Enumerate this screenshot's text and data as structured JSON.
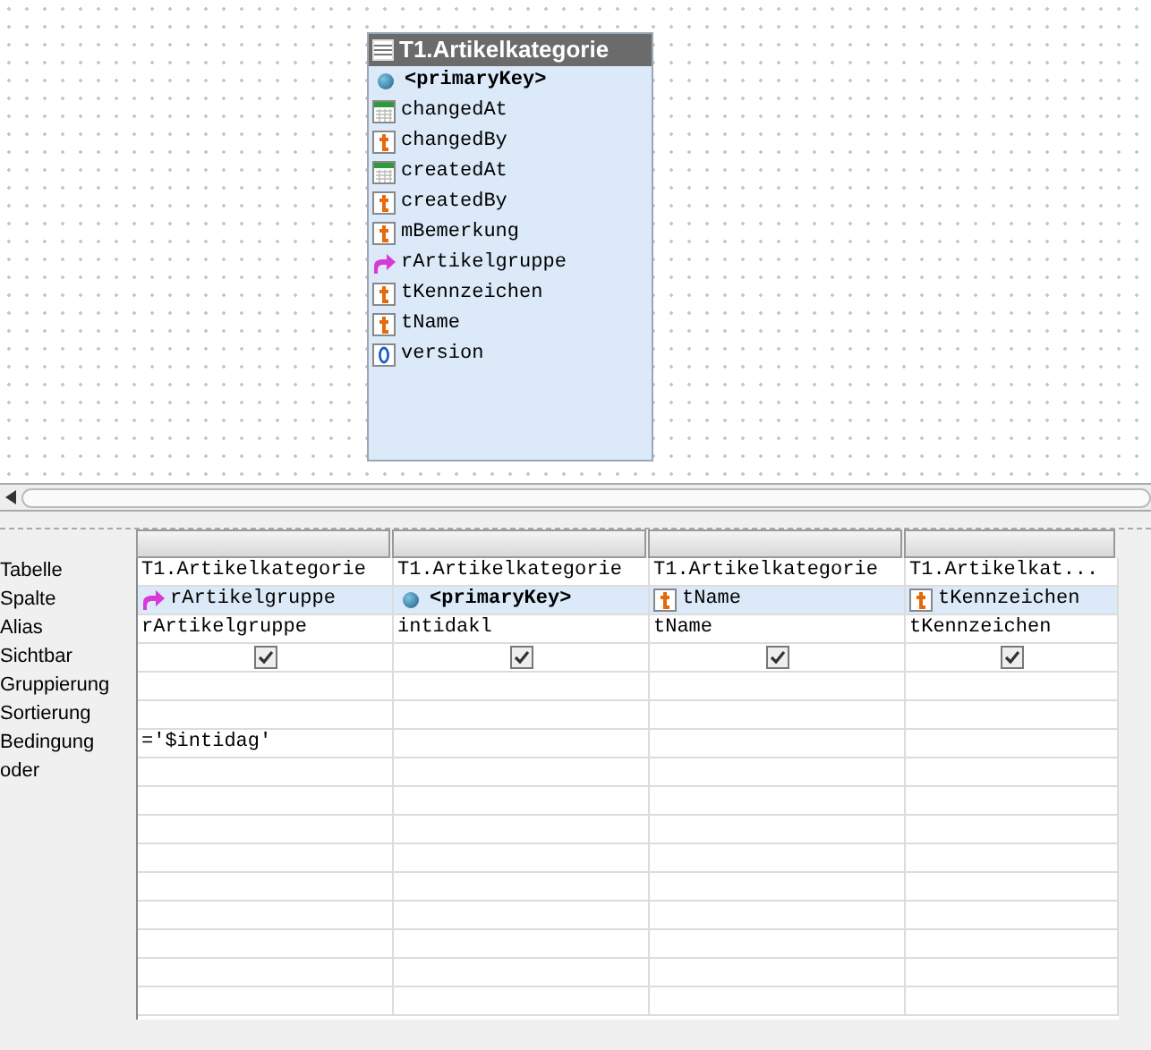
{
  "entity": {
    "title": "T1.Artikelkategorie",
    "fields": [
      {
        "name": "<primaryKey>",
        "kind": "key"
      },
      {
        "name": "changedAt",
        "kind": "date"
      },
      {
        "name": "changedBy",
        "kind": "text"
      },
      {
        "name": "createdAt",
        "kind": "date"
      },
      {
        "name": "createdBy",
        "kind": "text"
      },
      {
        "name": "mBemerkung",
        "kind": "text"
      },
      {
        "name": "rArtikelgruppe",
        "kind": "relation"
      },
      {
        "name": "tKennzeichen",
        "kind": "text"
      },
      {
        "name": "tName",
        "kind": "text"
      },
      {
        "name": "version",
        "kind": "number"
      }
    ]
  },
  "grid": {
    "row_labels": [
      "Tabelle",
      "Spalte",
      "Alias",
      "Sichtbar",
      "Gruppierung",
      "Sortierung",
      "Bedingung",
      "oder"
    ],
    "columns": [
      {
        "table": "T1.Artikelkategorie",
        "field": {
          "name": "rArtikelgruppe",
          "kind": "relation"
        },
        "alias": "rArtikelgruppe",
        "visible": true,
        "condition": "='$intidag'"
      },
      {
        "table": "T1.Artikelkategorie",
        "field": {
          "name": "<primaryKey>",
          "kind": "key"
        },
        "alias": "intidakl",
        "visible": true
      },
      {
        "table": "T1.Artikelkategorie",
        "field": {
          "name": "tName",
          "kind": "text"
        },
        "alias": "tName",
        "visible": true
      },
      {
        "table": "T1.Artikelkat...",
        "field": {
          "name": "tKennzeichen",
          "kind": "text"
        },
        "alias": "tKennzeichen",
        "visible": true
      }
    ]
  }
}
